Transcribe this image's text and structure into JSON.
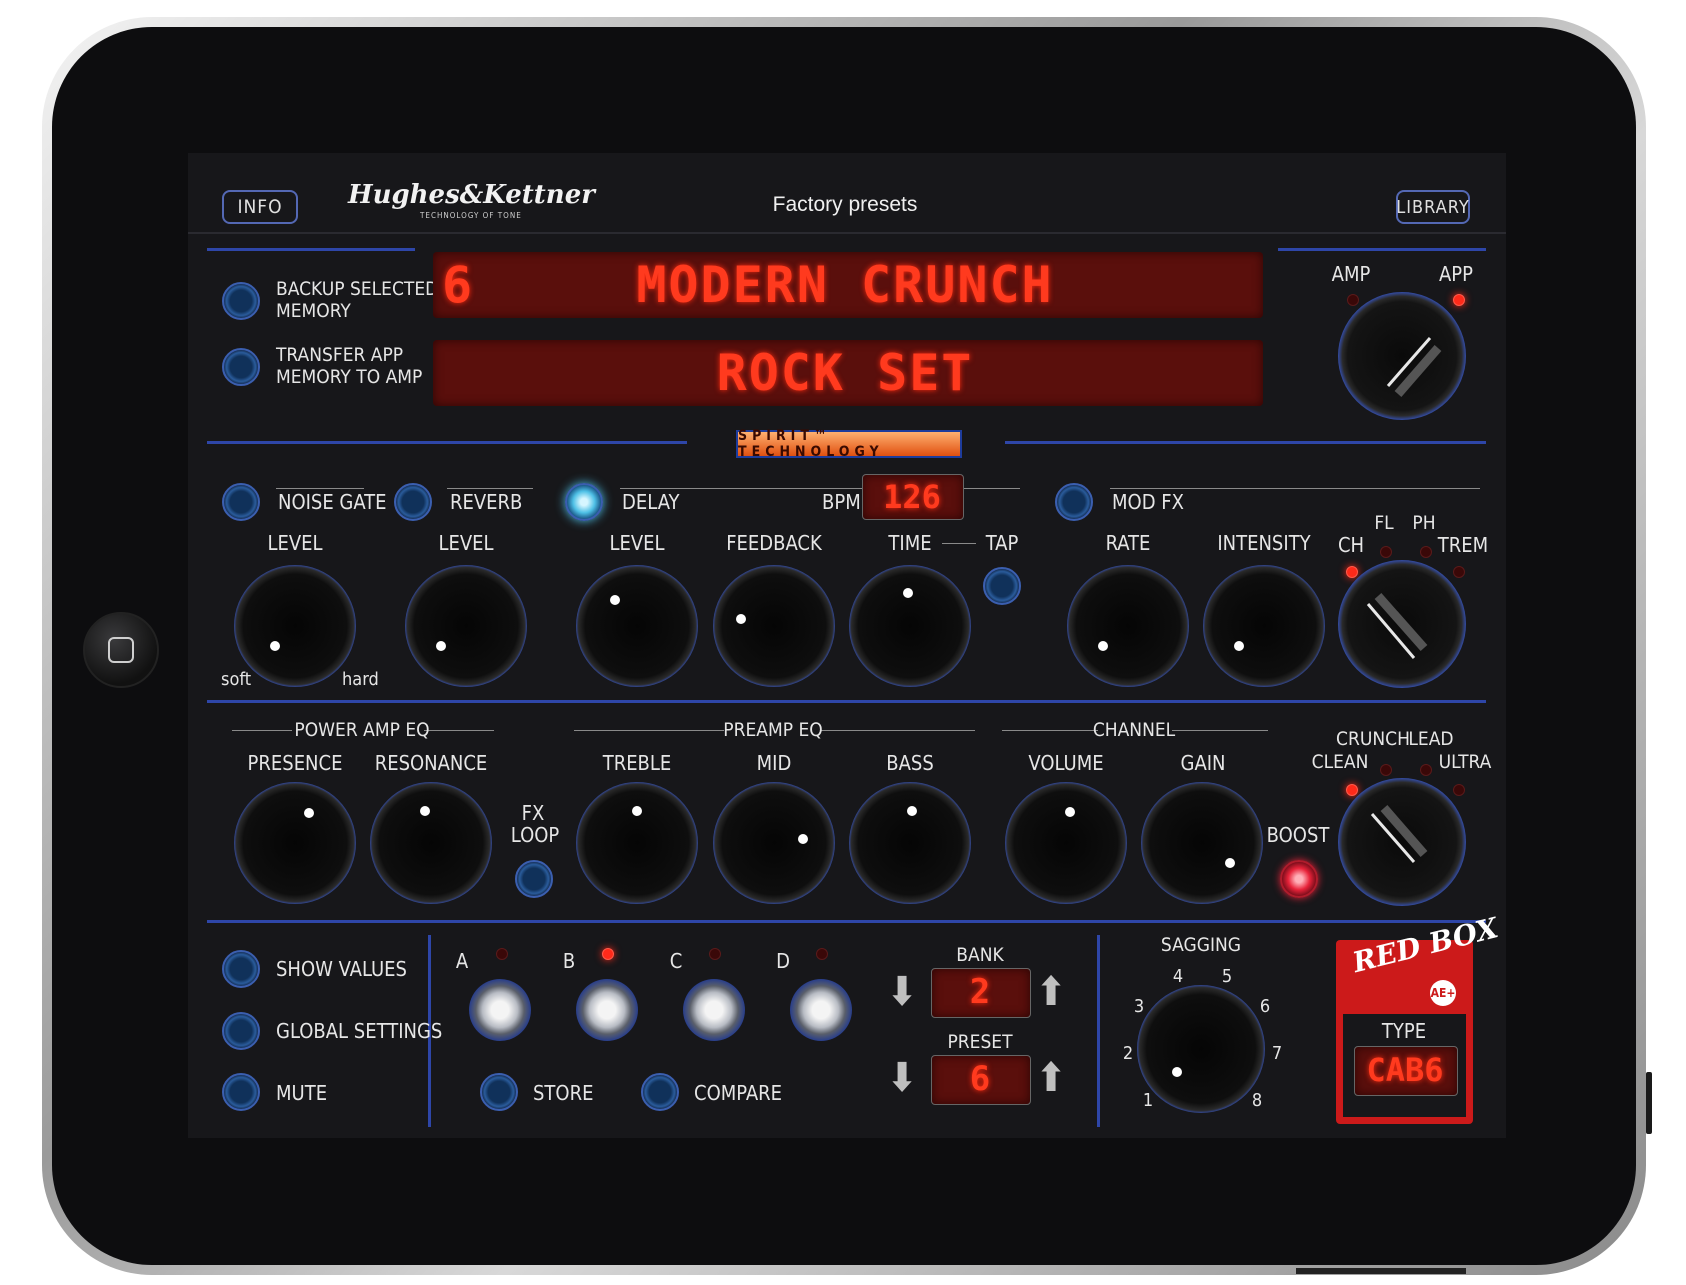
{
  "header": {
    "info": "INFO",
    "title": "Factory presets",
    "library": "LIBRARY",
    "logo_main": "Hughes&Kettner",
    "logo_sub": "TECHNOLOGY OF TONE"
  },
  "display": {
    "preset_number": "6",
    "preset_name": "MODERN CRUNCH",
    "bank_name": "ROCK SET"
  },
  "memory": {
    "backup": [
      "BACKUP SELECTED",
      "MEMORY"
    ],
    "transfer": [
      "TRANSFER APP",
      "MEMORY TO AMP"
    ]
  },
  "source": {
    "amp": "AMP",
    "app": "APP",
    "selected": "APP"
  },
  "spirit": "SPIRIT™ TECHNOLOGY",
  "fx": {
    "noise_gate": "NOISE GATE",
    "reverb": "REVERB",
    "delay": "DELAY",
    "bpm_label": "BPM",
    "bpm_value": "126",
    "mod_fx": "MOD FX",
    "level": "LEVEL",
    "feedback": "FEEDBACK",
    "time": "TIME",
    "tap": "TAP",
    "rate": "RATE",
    "intensity": "INTENSITY",
    "soft": "soft",
    "hard": "hard",
    "delay_on": true
  },
  "mod_types": {
    "ch": "CH",
    "fl": "FL",
    "ph": "PH",
    "trem": "TREM",
    "selected": "CH"
  },
  "eq": {
    "power_amp_eq": "POWER AMP EQ",
    "presence": "PRESENCE",
    "resonance": "RESONANCE",
    "fx_loop": [
      "FX",
      "LOOP"
    ],
    "preamp_eq": "PREAMP EQ",
    "treble": "TREBLE",
    "mid": "MID",
    "bass": "BASS",
    "channel": "CHANNEL",
    "volume": "VOLUME",
    "gain": "GAIN",
    "boost": "BOOST",
    "boost_on": true
  },
  "channels": {
    "clean": "CLEAN",
    "crunch": "CRUNCH",
    "lead": "LEAD",
    "ultra": "ULTRA",
    "selected": "CLEAN"
  },
  "bottom": {
    "show_values": "SHOW VALUES",
    "global_settings": "GLOBAL SETTINGS",
    "mute": "MUTE",
    "footswitches": [
      "A",
      "B",
      "C",
      "D"
    ],
    "active_footswitch": "B",
    "store": "STORE",
    "compare": "COMPARE",
    "bank_label": "BANK",
    "bank_value": "2",
    "preset_label": "PRESET",
    "preset_value": "6",
    "sagging_label": "SAGGING",
    "sagging_steps": [
      "1",
      "2",
      "3",
      "4",
      "5",
      "6",
      "7",
      "8"
    ],
    "redbox_logo": "RED BOX",
    "redbox_badge": "AE+",
    "redbox_type_label": "TYPE",
    "redbox_type_value": "CAB6"
  }
}
